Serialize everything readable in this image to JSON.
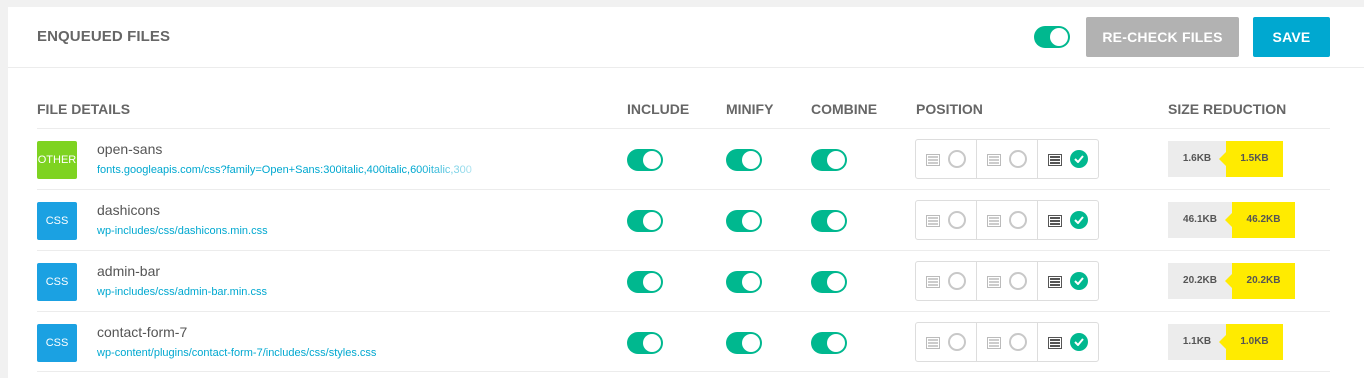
{
  "header": {
    "title": "ENQUEUED FILES",
    "master_toggle": true,
    "recheck_label": "RE-CHECK FILES",
    "save_label": "SAVE"
  },
  "columns": {
    "file_details": "FILE DETAILS",
    "include": "INCLUDE",
    "minify": "MINIFY",
    "combine": "COMBINE",
    "position": "POSITION",
    "size_reduction": "SIZE REDUCTION"
  },
  "colors": {
    "toggle_on": "#00b88f",
    "badge_other": "#7ed321",
    "badge_css": "#1ba1e2",
    "save": "#00a8d0",
    "size_after": "#ffeb00"
  },
  "rows": [
    {
      "type": "OTHER",
      "name": "open-sans",
      "url": "fonts.googleapis.com/css?family=Open+Sans:300italic,400italic,600italic,300",
      "include": true,
      "minify": true,
      "combine": true,
      "position": "footer",
      "size_before": "1.6KB",
      "size_after": "1.5KB"
    },
    {
      "type": "CSS",
      "name": "dashicons",
      "url": "wp-includes/css/dashicons.min.css",
      "include": true,
      "minify": true,
      "combine": true,
      "position": "footer",
      "size_before": "46.1KB",
      "size_after": "46.2KB"
    },
    {
      "type": "CSS",
      "name": "admin-bar",
      "url": "wp-includes/css/admin-bar.min.css",
      "include": true,
      "minify": true,
      "combine": true,
      "position": "footer",
      "size_before": "20.2KB",
      "size_after": "20.2KB"
    },
    {
      "type": "CSS",
      "name": "contact-form-7",
      "url": "wp-content/plugins/contact-form-7/includes/css/styles.css",
      "include": true,
      "minify": true,
      "combine": true,
      "position": "footer",
      "size_before": "1.1KB",
      "size_after": "1.0KB"
    }
  ]
}
